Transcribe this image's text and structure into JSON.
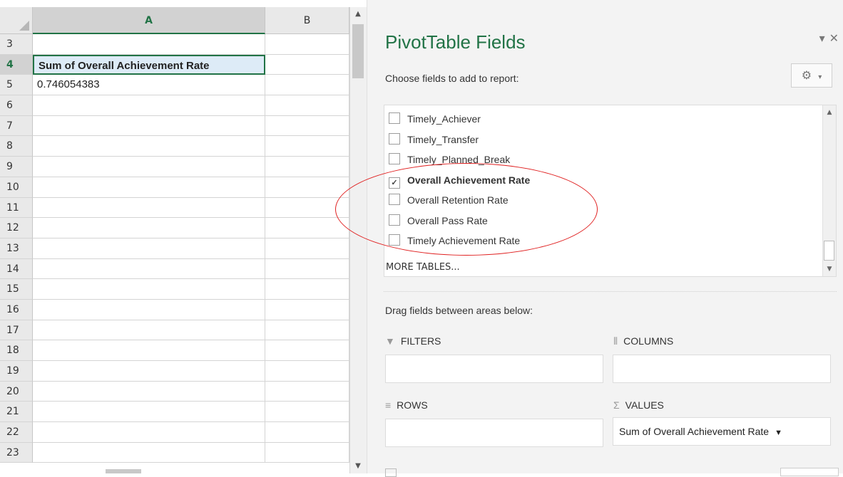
{
  "spreadsheet": {
    "columns": [
      "A",
      "B"
    ],
    "rows": [
      {
        "num": "3",
        "a": ""
      },
      {
        "num": "4",
        "a": "Sum of Overall Achievement Rate"
      },
      {
        "num": "5",
        "a": "0.746054383"
      },
      {
        "num": "6",
        "a": ""
      },
      {
        "num": "7",
        "a": ""
      },
      {
        "num": "8",
        "a": ""
      },
      {
        "num": "9",
        "a": ""
      },
      {
        "num": "10",
        "a": ""
      },
      {
        "num": "11",
        "a": ""
      },
      {
        "num": "12",
        "a": ""
      },
      {
        "num": "13",
        "a": ""
      },
      {
        "num": "14",
        "a": ""
      },
      {
        "num": "15",
        "a": ""
      },
      {
        "num": "16",
        "a": ""
      },
      {
        "num": "17",
        "a": ""
      },
      {
        "num": "18",
        "a": ""
      },
      {
        "num": "19",
        "a": ""
      },
      {
        "num": "20",
        "a": ""
      },
      {
        "num": "21",
        "a": ""
      },
      {
        "num": "22",
        "a": ""
      },
      {
        "num": "23",
        "a": ""
      }
    ]
  },
  "pivot": {
    "title": "PivotTable Fields",
    "choose_label": "Choose fields to add to report:",
    "fields": [
      {
        "label": "Timely_Achiever",
        "checked": false
      },
      {
        "label": "Timely_Transfer",
        "checked": false
      },
      {
        "label": "Timely_Planned_Break",
        "checked": false
      },
      {
        "label": "Overall Achievement Rate",
        "checked": true
      },
      {
        "label": "Overall Retention Rate",
        "checked": false
      },
      {
        "label": "Overall Pass Rate",
        "checked": false
      },
      {
        "label": "Timely Achievement Rate",
        "checked": false
      }
    ],
    "more_tables": "MORE TABLES...",
    "drag_label": "Drag fields between areas below:",
    "areas": {
      "filters": "FILTERS",
      "columns": "COLUMNS",
      "rows": "ROWS",
      "values": "VALUES"
    },
    "values_item": "Sum of Overall Achievement Rate"
  },
  "icons": {
    "checkmark": "✓",
    "dropdown": "▼",
    "pane_menu": "▾",
    "close": "✕",
    "gear": "⚙",
    "filter": "▼",
    "columns": "⦀",
    "rows": "≡",
    "sigma": "Σ",
    "scroll_up": "▲",
    "scroll_down": "▼"
  },
  "colors": {
    "excel_green": "#217346",
    "annotation_red": "#e02020",
    "selected_cell_fill": "#ddebf7"
  }
}
